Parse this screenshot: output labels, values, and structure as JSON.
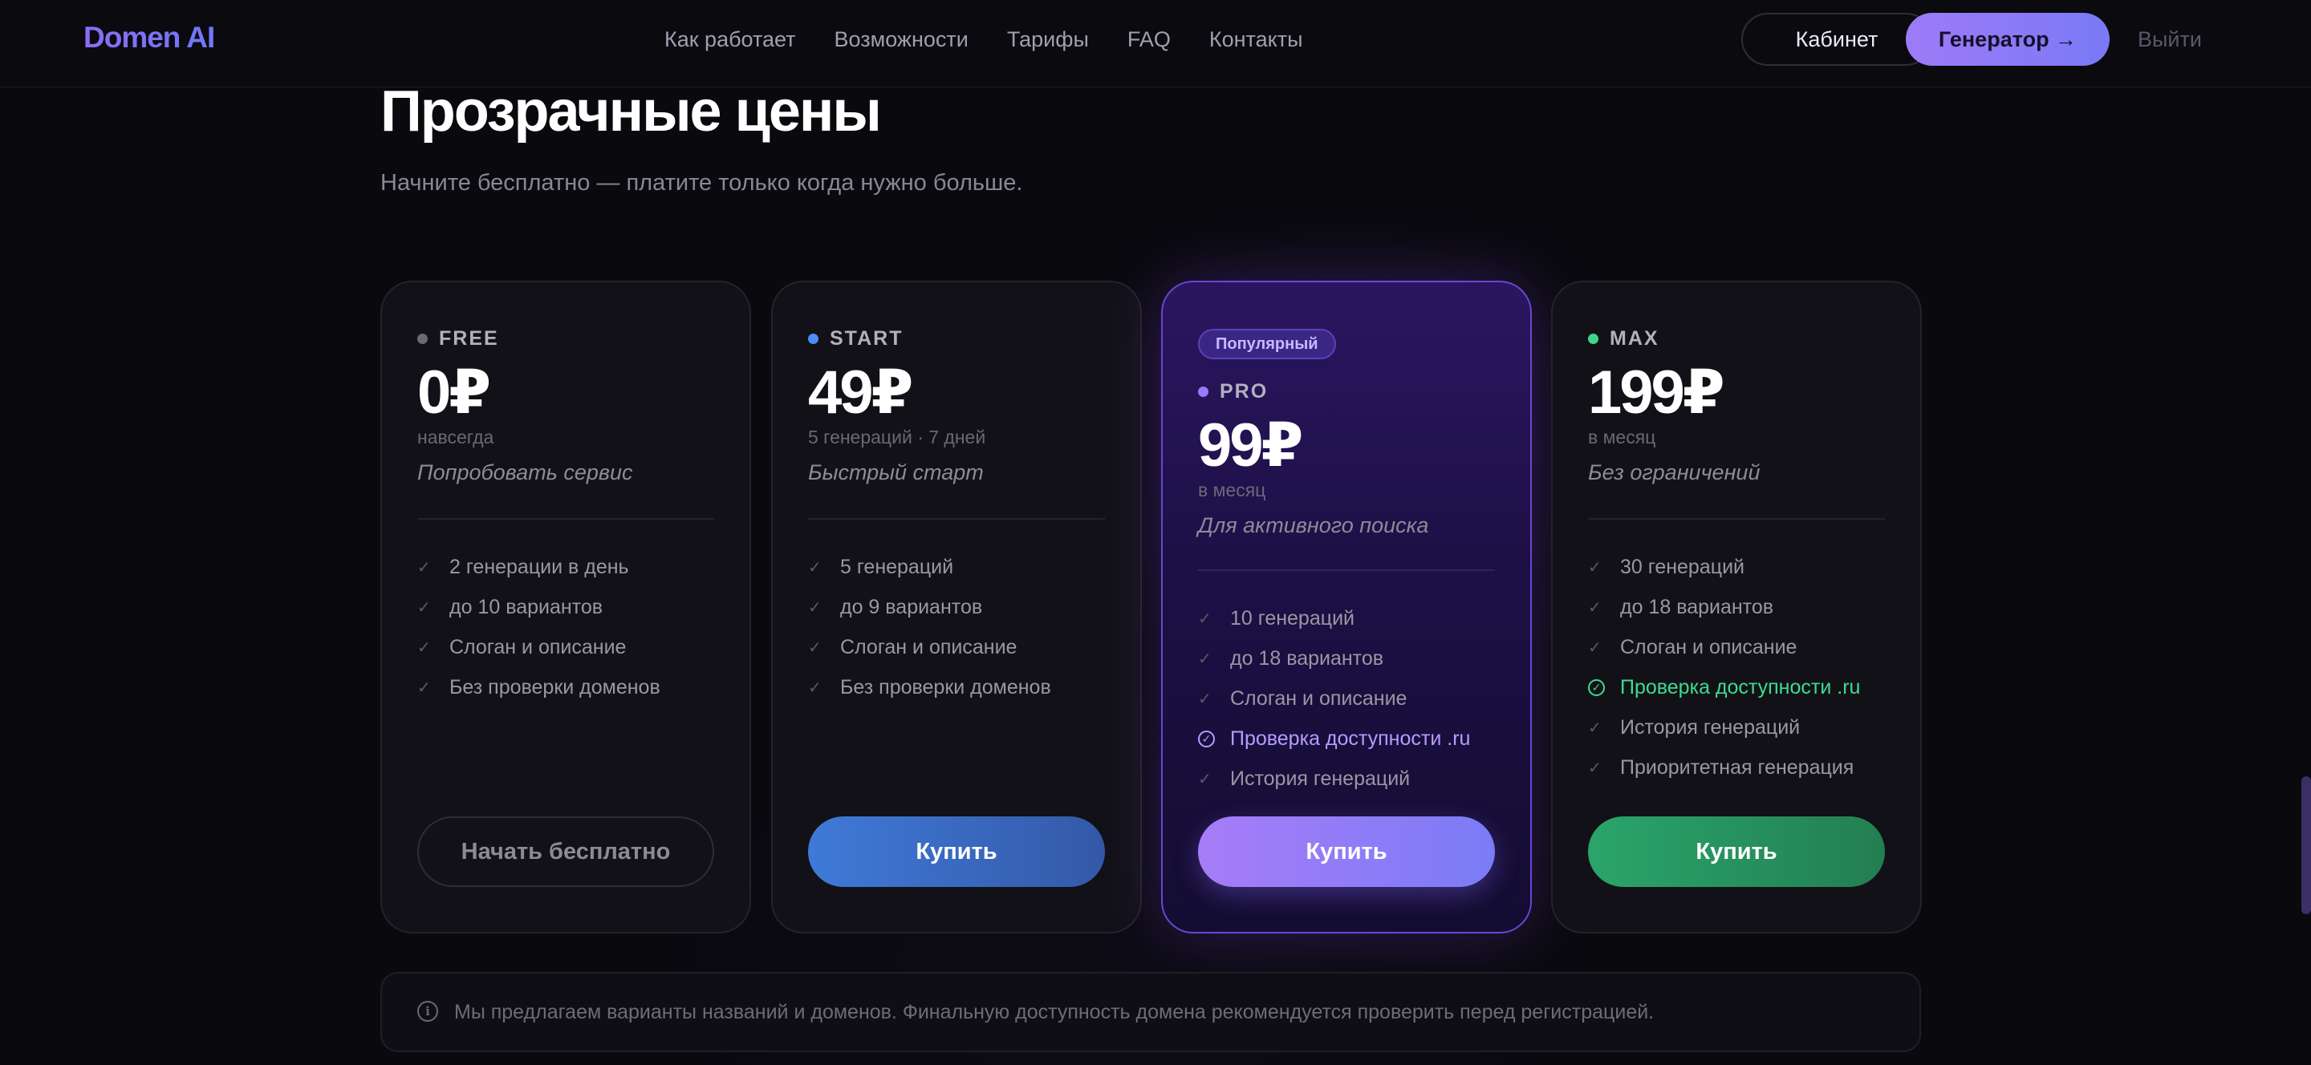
{
  "header": {
    "logo": "Domen AI",
    "nav": [
      "Как работает",
      "Возможности",
      "Тарифы",
      "FAQ",
      "Контакты"
    ],
    "cabinet_label": "Кабинет",
    "generator_label": "Генератор →",
    "logout_label": "Выйти"
  },
  "pricing": {
    "title": "Прозрачные цены",
    "subtitle": "Начните бесплатно — платите только когда нужно больше.",
    "plans": [
      {
        "tier": "FREE",
        "price": "0₽",
        "period": "навсегда",
        "tagline": "Попробовать сервис",
        "features": [
          "2 генерации в день",
          "до 10 вариантов",
          "Слоган и описание",
          "Без проверки доменов"
        ],
        "cta": "Начать бесплатно",
        "dot_color": "#6b6a72"
      },
      {
        "tier": "START",
        "price": "49₽",
        "period": "5 генераций · 7 дней",
        "tagline": "Быстрый старт",
        "features": [
          "5 генераций",
          "до 9 вариантов",
          "Слоган и описание",
          "Без проверки доменов"
        ],
        "cta": "Купить",
        "dot_color": "#4a8df7"
      },
      {
        "badge": "Популярный",
        "tier": "PRO",
        "price": "99₽",
        "period": "в месяц",
        "tagline": "Для активного поиска",
        "features": [
          "10 генераций",
          "до 18 вариантов",
          "Слоган и описание",
          "Проверка доступности .ru",
          "История генераций"
        ],
        "cta": "Купить",
        "dot_color": "#9a78ff",
        "highlight_color": "#b79bff"
      },
      {
        "tier": "MAX",
        "price": "199₽",
        "period": "в месяц",
        "tagline": "Без ограничений",
        "features": [
          "30 генераций",
          "до 18 вариантов",
          "Слоган и описание",
          "Проверка доступности .ru",
          "История генераций",
          "Приоритетная генерация"
        ],
        "cta": "Купить",
        "dot_color": "#3dd68c",
        "highlight_color": "#3ddc8f"
      }
    ],
    "note": "Мы предлагаем варианты названий и доменов. Финальную доступность домена рекомендуется проверить перед регистрацией."
  }
}
